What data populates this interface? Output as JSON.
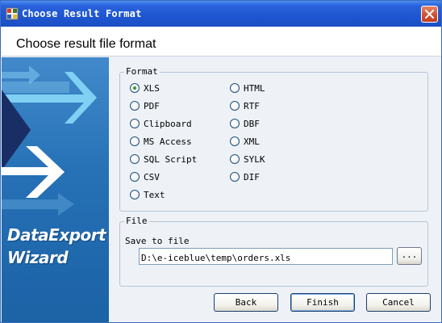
{
  "window": {
    "title": "Choose Result Format",
    "icon": "app-icon",
    "close_icon": "close-icon"
  },
  "header": {
    "title": "Choose result file format"
  },
  "banner": {
    "line1": "DataExport",
    "line2": "Wizard",
    "icon": "arrow-icon"
  },
  "format": {
    "legend": "Format",
    "selected": "XLS",
    "options": [
      "XLS",
      "PDF",
      "Clipboard",
      "MS Access",
      "SQL Script",
      "CSV",
      "Text",
      "HTML",
      "RTF",
      "DBF",
      "XML",
      "SYLK",
      "DIF"
    ]
  },
  "file": {
    "legend": "File",
    "save_label": "Save to file",
    "path": "D:\\e-iceblue\\temp\\orders.xls",
    "browse_label": "..."
  },
  "buttons": {
    "back": "Back",
    "finish": "Finish",
    "cancel": "Cancel"
  },
  "colors": {
    "titlebar": "#1e55d0",
    "banner": "#1f6cb3",
    "radio_dot": "#2a9b2a"
  }
}
